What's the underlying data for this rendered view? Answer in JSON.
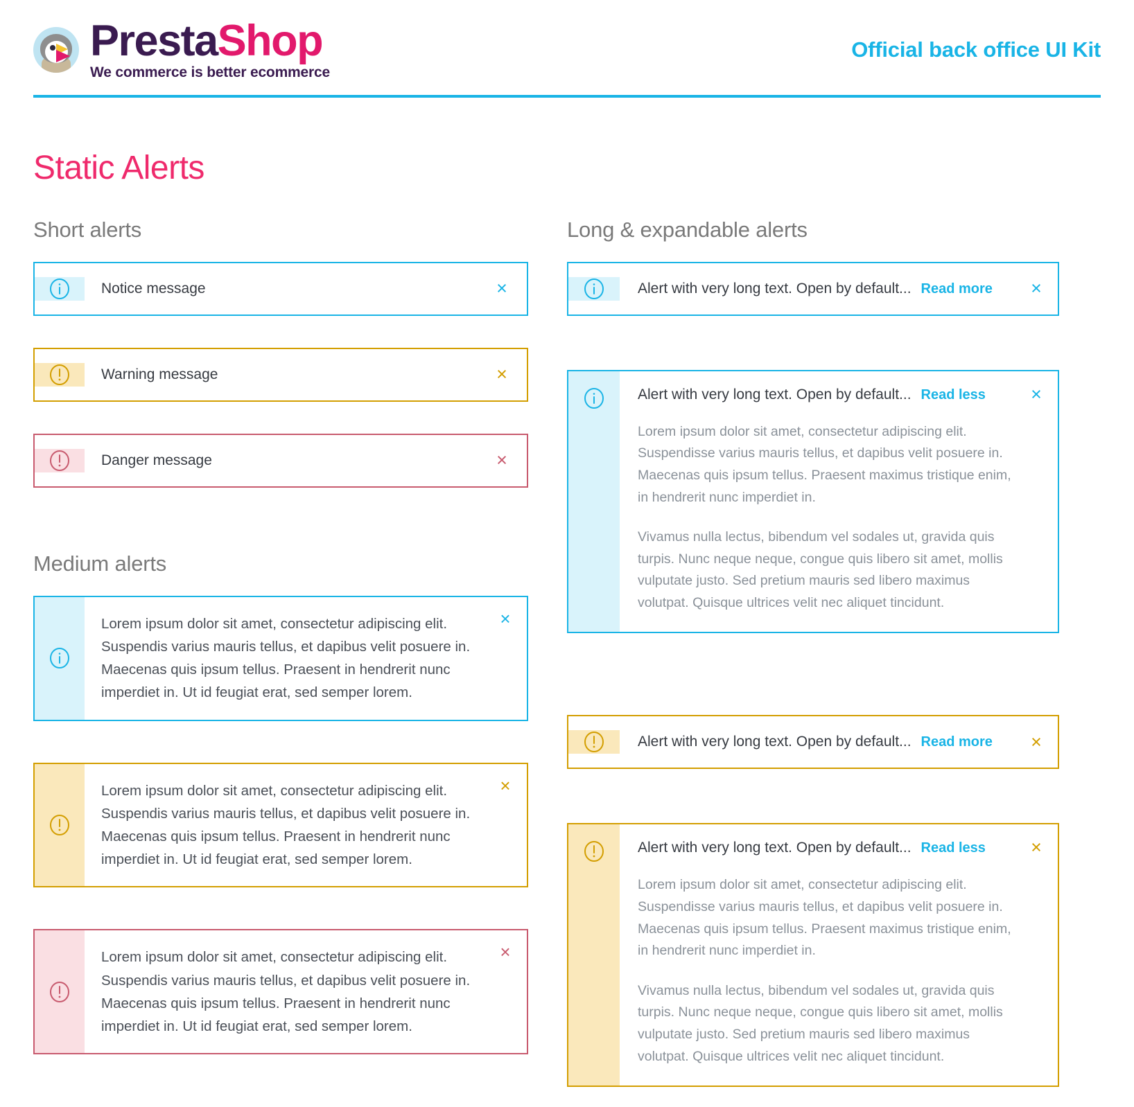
{
  "header": {
    "brand_first": "Presta",
    "brand_second": "Shop",
    "tagline": "We commerce is better ecommerce",
    "kit_title": "Official back office UI Kit",
    "accent_color": "#19b4e6"
  },
  "page": {
    "title": "Static Alerts",
    "title_color": "#ef2a6c"
  },
  "sections": {
    "short": "Short alerts",
    "medium": "Medium alerts",
    "long": "Long & expandable alerts"
  },
  "colors": {
    "notice": "#19b4e6",
    "notice_tint": "#d9f3fb",
    "warning": "#d39e00",
    "warning_tint": "#fae8bb",
    "danger": "#c85a6e",
    "danger_tint": "#fadfe3",
    "body_text": "#363a41",
    "muted_text": "#8a9199"
  },
  "icons": {
    "notice": "info-circle-icon",
    "warning": "exclamation-circle-icon",
    "danger": "exclamation-circle-icon",
    "close": "close-icon"
  },
  "short_alerts": [
    {
      "variant": "notice",
      "text": "Notice message",
      "close_label": "×"
    },
    {
      "variant": "warning",
      "text": "Warning message",
      "close_label": "×"
    },
    {
      "variant": "danger",
      "text": "Danger message",
      "close_label": "×"
    }
  ],
  "medium_alert_text": "Lorem ipsum dolor sit amet, consectetur adipiscing elit. Suspendis varius mauris tellus, et dapibus velit posuere in. Maecenas quis ipsum tellus. Praesent in hendrerit nunc imperdiet in. Ut id feugiat erat, sed semper lorem.",
  "medium_alerts": [
    {
      "variant": "notice",
      "close_label": "×"
    },
    {
      "variant": "warning",
      "close_label": "×"
    },
    {
      "variant": "danger",
      "close_label": "×"
    }
  ],
  "long_alerts": [
    {
      "variant": "notice",
      "state": "collapsed",
      "headline": "Alert with very long text. Open by default...",
      "toggle_label": "Read more",
      "close_label": "×"
    },
    {
      "variant": "notice",
      "state": "expanded",
      "headline": "Alert with very long text. Open by default...",
      "toggle_label": "Read less",
      "close_label": "×",
      "paragraph_1": "Lorem ipsum dolor sit amet, consectetur adipiscing elit. Suspendisse varius mauris tellus, et dapibus velit posuere in. Maecenas quis ipsum tellus. Praesent maximus tristique enim, in hendrerit nunc imperdiet in.",
      "paragraph_2": "Vivamus nulla lectus, bibendum vel sodales ut, gravida quis turpis. Nunc neque neque, congue quis libero sit amet, mollis vulputate justo. Sed pretium mauris sed libero maximus volutpat. Quisque ultrices velit nec aliquet tincidunt."
    },
    {
      "variant": "warning",
      "state": "collapsed",
      "headline": "Alert with very long text. Open by default...",
      "toggle_label": "Read more",
      "close_label": "×"
    },
    {
      "variant": "warning",
      "state": "expanded",
      "headline": "Alert with very long text. Open by default...",
      "toggle_label": "Read less",
      "close_label": "×",
      "paragraph_1": "Lorem ipsum dolor sit amet, consectetur adipiscing elit. Suspendisse varius mauris tellus, et dapibus velit posuere in. Maecenas quis ipsum tellus. Praesent maximus tristique enim, in hendrerit nunc imperdiet in.",
      "paragraph_2": "Vivamus nulla lectus, bibendum vel sodales ut, gravida quis turpis. Nunc neque neque, congue quis libero sit amet, mollis vulputate justo. Sed pretium mauris sed libero maximus volutpat. Quisque ultrices velit nec aliquet tincidunt."
    }
  ]
}
